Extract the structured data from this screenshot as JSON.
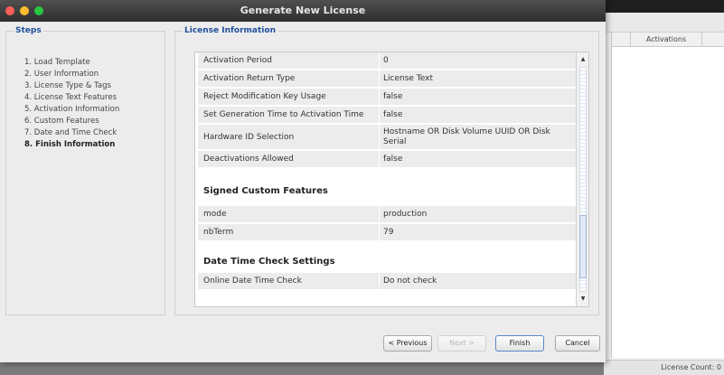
{
  "window": {
    "title": "Generate New License"
  },
  "steps": {
    "heading": "Steps",
    "items": [
      {
        "label": "1. Load Template"
      },
      {
        "label": "2. User Information"
      },
      {
        "label": "3. License Type & Tags"
      },
      {
        "label": "4. License Text Features"
      },
      {
        "label": "5. Activation Information"
      },
      {
        "label": "6. Custom Features"
      },
      {
        "label": "7. Date and Time Check"
      },
      {
        "label": "8. Finish Information"
      }
    ],
    "active_index": 7
  },
  "license_info": {
    "heading": "License Information",
    "activation_rows": [
      {
        "key": "Activation Period",
        "value": "0"
      },
      {
        "key": "Activation Return Type",
        "value": "License Text"
      },
      {
        "key": "Reject Modification Key Usage",
        "value": "false"
      },
      {
        "key": "Set Generation Time to Activation Time",
        "value": "false"
      },
      {
        "key": "Hardware ID Selection",
        "value": "Hostname OR Disk Volume UUID OR Disk Serial"
      },
      {
        "key": "Deactivations Allowed",
        "value": "false"
      }
    ],
    "custom_features": {
      "title": "Signed Custom Features",
      "rows": [
        {
          "key": "mode",
          "value": "production"
        },
        {
          "key": "nbTerm",
          "value": "79"
        }
      ]
    },
    "date_time": {
      "title": "Date Time Check Settings",
      "rows": [
        {
          "key": "Online Date Time Check",
          "value": "Do not check"
        }
      ]
    }
  },
  "buttons": {
    "previous": "< Previous",
    "next": "Next >",
    "finish": "Finish",
    "cancel": "Cancel"
  },
  "background_app": {
    "column_header": "Activations",
    "status": "License Count: 0"
  },
  "colors": {
    "heading_blue": "#1f4f9a",
    "row_grey": "#ececec",
    "titlebar": "#3a3a3a"
  }
}
